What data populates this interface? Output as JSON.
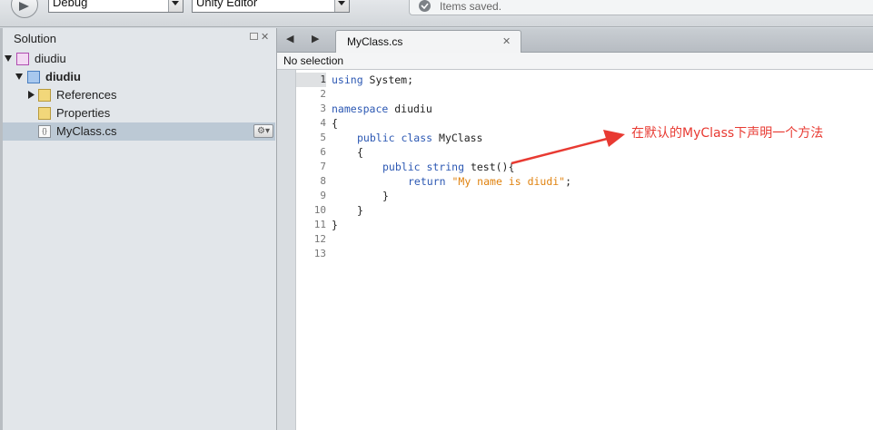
{
  "toolbar": {
    "config_select": "Debug",
    "target_select": "Unity Editor",
    "status_message": "Items saved."
  },
  "solution_pad": {
    "title": "Solution",
    "pin_icon": "pin-icon",
    "close_icon": "close-icon",
    "items": [
      {
        "label": "diudiu",
        "icon": "solution-icon"
      },
      {
        "label": "diudiu",
        "icon": "project-icon"
      },
      {
        "label": "References",
        "icon": "references-folder-icon"
      },
      {
        "label": "Properties",
        "icon": "folder-icon"
      },
      {
        "label": "MyClass.cs",
        "icon": "csharp-file-icon"
      }
    ]
  },
  "editor": {
    "tab_label": "MyClass.cs",
    "path_label": "No selection",
    "line_numbers": [
      "1",
      "2",
      "3",
      "4",
      "5",
      "6",
      "7",
      "8",
      "9",
      "10",
      "11",
      "12",
      "13"
    ],
    "code": {
      "l1_kw": "using",
      "l1_rest": " System;",
      "l3_kw": "namespace",
      "l3_rest": " diudiu",
      "l4": "{",
      "l5_kw": "public class",
      "l5_rest": " MyClass",
      "l6": "{",
      "l7_kw": "public string",
      "l7_rest": " test(){",
      "l8_kw": "return",
      "l8_str": "\"My name is diudi\"",
      "l8_rest": ";",
      "l9": "}",
      "l10": "}",
      "l11": "}"
    }
  },
  "annotation": {
    "text": "在默认的MyClass下声明一个方法",
    "color": "#e83a32"
  },
  "colors": {
    "keyword": "#2c58b3",
    "string": "#e0820e",
    "selection": "#bcc9d5"
  }
}
